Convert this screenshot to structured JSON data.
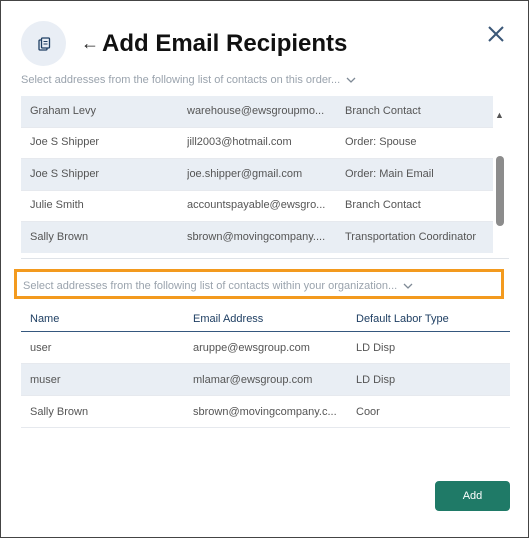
{
  "dialog": {
    "title": "Add Email Recipients",
    "back_glyph": "←",
    "order_contacts_hint": "Select addresses from the following list of contacts on this order...",
    "org_contacts_hint": "Select addresses from the following list of contacts within your organization...",
    "add_label": "Add"
  },
  "order_contacts": [
    {
      "name": "Graham Levy",
      "email": "warehouse@ewsgroupmo...",
      "type": "Branch Contact"
    },
    {
      "name": "Joe S Shipper",
      "email": "jill2003@hotmail.com",
      "type": "Order: Spouse"
    },
    {
      "name": "Joe S Shipper",
      "email": "joe.shipper@gmail.com",
      "type": "Order: Main Email"
    },
    {
      "name": "Julie Smith",
      "email": "accountspayable@ewsgro...",
      "type": "Branch Contact"
    },
    {
      "name": "Sally Brown",
      "email": "sbrown@movingcompany....",
      "type": "Transportation Coordinator"
    }
  ],
  "org_table": {
    "headers": {
      "name": "Name",
      "email": "Email Address",
      "labor": "Default Labor Type"
    },
    "rows": [
      {
        "name": "user",
        "email": "aruppe@ewsgroup.com",
        "labor": "LD Disp"
      },
      {
        "name": "muser",
        "email": "mlamar@ewsgroup.com",
        "labor": "LD Disp"
      },
      {
        "name": "Sally Brown",
        "email": "sbrown@movingcompany.c...",
        "labor": "Coor"
      }
    ]
  },
  "colors": {
    "accent": "#1f7a67",
    "highlight": "#f39a1e",
    "header_text": "#1f3f63"
  }
}
